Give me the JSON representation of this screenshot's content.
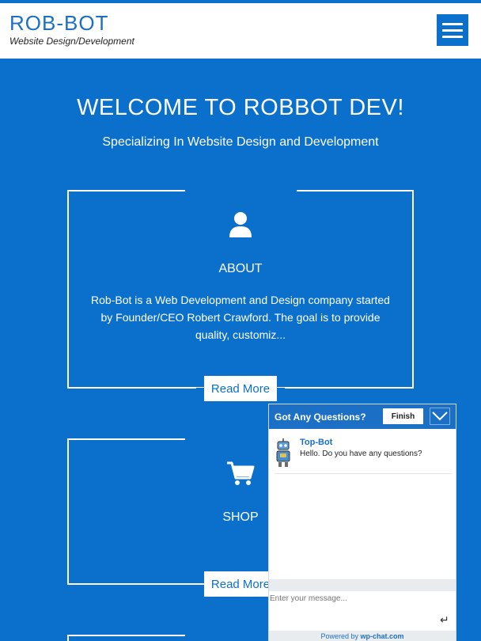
{
  "header": {
    "brand": "ROB-BOT",
    "tagline": "Website Design/Development",
    "menu_icon": "hamburger-menu-icon"
  },
  "hero": {
    "title": "WELCOME TO ROBBOT DEV!",
    "subtitle": "Specializing In Website Design and Development"
  },
  "cards": [
    {
      "icon": "user-icon",
      "title": "ABOUT",
      "text": "Rob-Bot is a Web Development and Design company started by Founder/CEO Robert Crawford. The goal is to provide quality, customiz...",
      "button": "Read More"
    },
    {
      "icon": "shopping-cart-icon",
      "title": "SHOP",
      "button": "Read More"
    }
  ],
  "chat": {
    "title": "Got Any Questions?",
    "finish_label": "Finish",
    "collapse_icon": "chevron-down-icon",
    "message": {
      "author": "Top-Bot",
      "text": "Hello. Do you have any questions?",
      "avatar_icon": "robot-avatar-icon"
    },
    "input_placeholder": "Enter your message...",
    "send_icon": "enter-return-icon",
    "footer_prefix": "Powered by ",
    "footer_brand": "wp-chat.com"
  },
  "colors": {
    "primary_blue": "#0a70cc",
    "chat_header_blue": "#1b6fc4",
    "white": "#ffffff"
  }
}
